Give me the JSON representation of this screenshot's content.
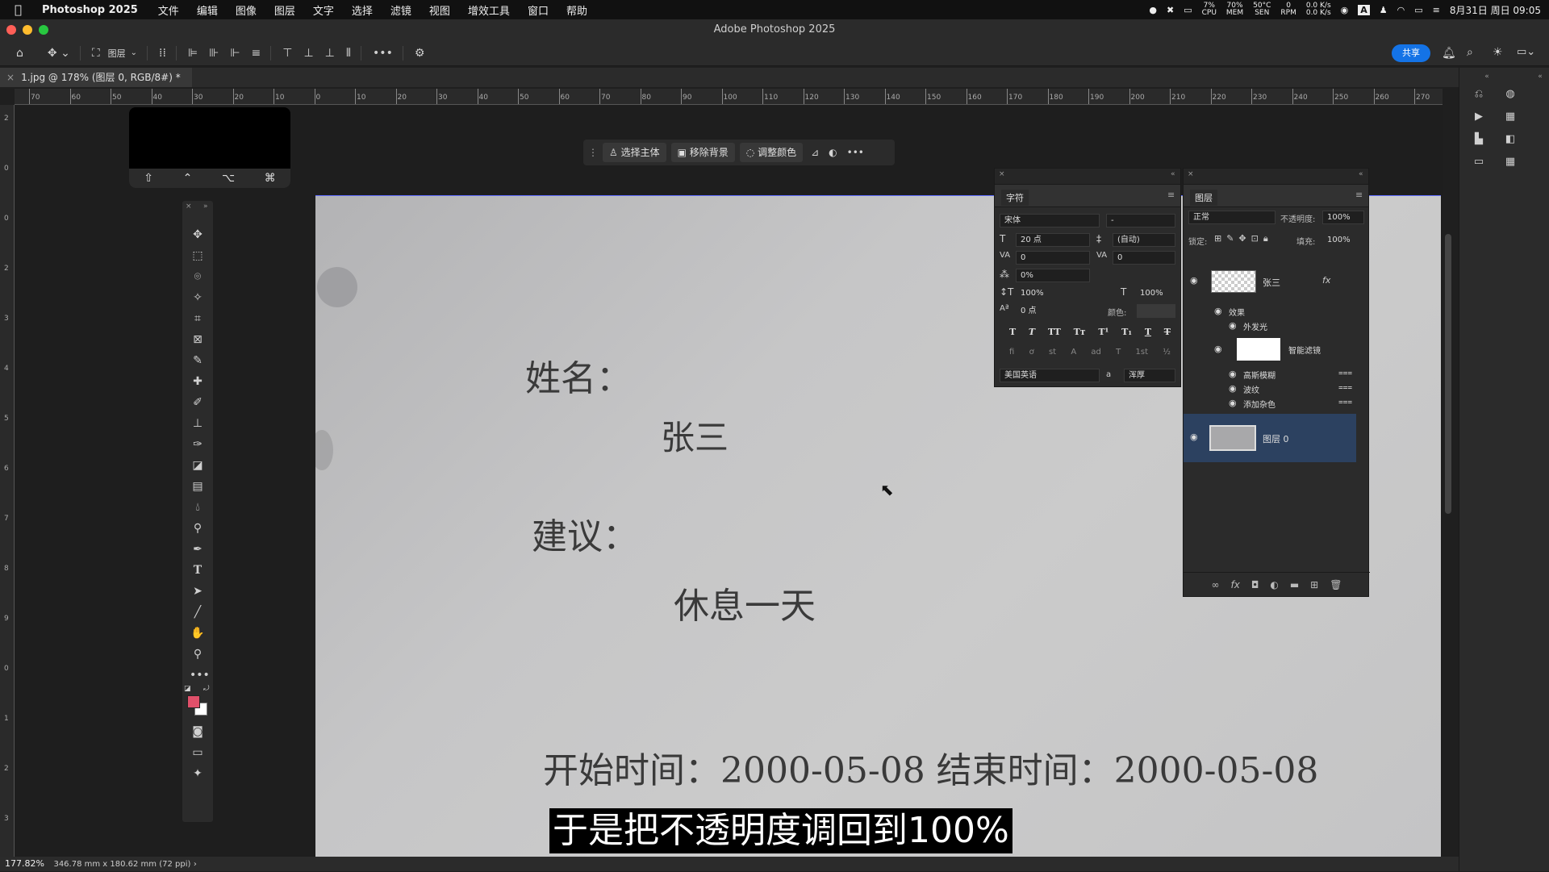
{
  "menubar": {
    "app_name": "Photoshop 2025",
    "items": [
      "文件",
      "编辑",
      "图像",
      "图层",
      "文字",
      "选择",
      "滤镜",
      "视图",
      "增效工具",
      "窗口",
      "帮助"
    ],
    "cpu": "7%",
    "cpu_label": "CPU",
    "mem": "70%",
    "mem_label": "MEM",
    "temp": "50°C",
    "temp_label": "SEN",
    "rpm": "0",
    "rpm_label": "RPM",
    "net_up": "0.0 K/s",
    "net_down": "0.0 K/s",
    "input_method": "A",
    "datetime": "8月31日 周日 09:05"
  },
  "window": {
    "title": "Adobe Photoshop 2025"
  },
  "optbar": {
    "layer_select": "图层",
    "share_label": "共享"
  },
  "document": {
    "tab_title": "1.jpg @ 178% (图层 0, RGB/8#) *"
  },
  "ruler": {
    "labels": [
      "70",
      "60",
      "50",
      "40",
      "30",
      "20",
      "10",
      "0",
      "10",
      "20",
      "30",
      "40",
      "50",
      "60",
      "70",
      "80",
      "90",
      "100",
      "110",
      "120",
      "130",
      "140",
      "150",
      "160",
      "170",
      "180",
      "190",
      "200",
      "210",
      "220",
      "230",
      "240",
      "250",
      "260",
      "270"
    ]
  },
  "vruler": {
    "labels": [
      "2",
      "0",
      "0",
      "2",
      "3",
      "4",
      "5",
      "6",
      "7",
      "8",
      "9",
      "0",
      "1",
      "2",
      "3"
    ]
  },
  "keys_widget": {
    "keys": [
      "⇧",
      "⌃",
      "⌥",
      "⌘"
    ]
  },
  "ctxbar": {
    "select_subject": "选择主体",
    "remove_bg": "移除背景",
    "adjust_color": "调整颜色"
  },
  "image_text": {
    "name_label": "姓名：",
    "name_value": "张三",
    "advice_label": "建议：",
    "advice_value": "休息一天",
    "dates": "开始时间：2000-05-08 结束时间：2000-05-08"
  },
  "character_panel": {
    "title": "字符",
    "font_family": "宋体",
    "font_style": "-",
    "size": "20 点",
    "leading": "(自动)",
    "kerning": "0",
    "tracking": "0",
    "tsume": "0%",
    "vscale": "100%",
    "hscale": "100%",
    "baseline": "0 点",
    "color_label": "颜色:",
    "language": "美国英语",
    "aa_label": "a",
    "aa_method": "浑厚",
    "style_buttons": [
      "T",
      "T",
      "TT",
      "Tт",
      "T¹",
      "T₁",
      "T",
      "T"
    ],
    "ot_buttons": [
      "ﬁ",
      "ơ",
      "st",
      "A",
      "ad",
      "T",
      "1st",
      "½"
    ]
  },
  "layers_panel": {
    "title": "图层",
    "blend_mode": "正常",
    "opacity_label": "不透明度:",
    "opacity": "100%",
    "lock_label": "锁定:",
    "fill_label": "填充:",
    "fill": "100%",
    "layers": [
      {
        "name": "张三",
        "fx": "fx"
      },
      {
        "name": "图层 0"
      }
    ],
    "effects_label": "效果",
    "outer_glow": "外发光",
    "smart_filters": "智能滤镜",
    "filters": [
      "高斯模糊",
      "波纹",
      "添加杂色"
    ]
  },
  "status": {
    "zoom": "177.82%",
    "doc_size": "346.78 mm x 180.62 mm (72 ppi)"
  },
  "subtitle": "于是把不透明度调回到100%",
  "colors": {
    "foreground": "#e0506a",
    "background": "#ffffff",
    "accent": "#1473e6",
    "selected_layer": "#2c4160"
  }
}
